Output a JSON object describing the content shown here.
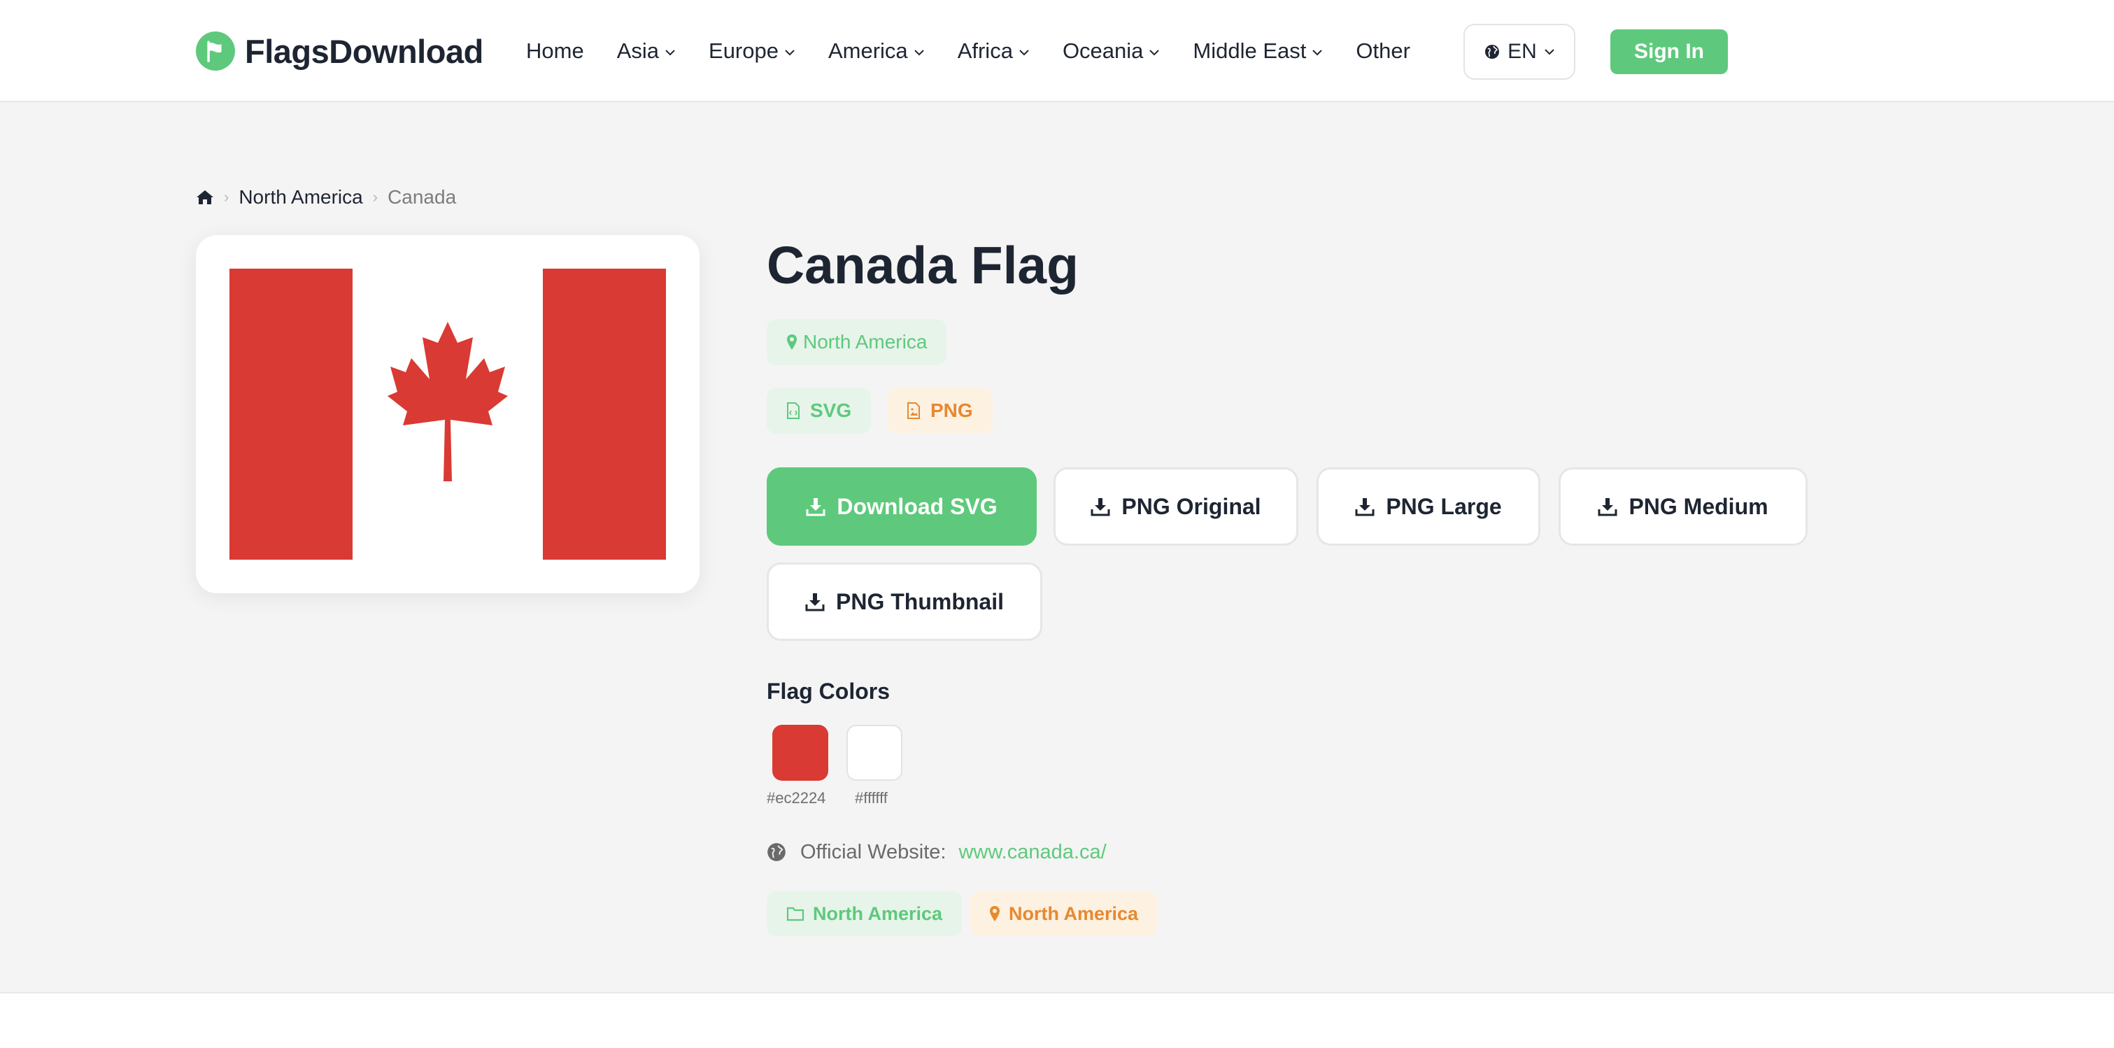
{
  "brand": {
    "name": "FlagsDownload",
    "accent": "#5ec97c"
  },
  "nav": {
    "items": [
      {
        "label": "Home",
        "dropdown": false
      },
      {
        "label": "Asia",
        "dropdown": true
      },
      {
        "label": "Europe",
        "dropdown": true
      },
      {
        "label": "America",
        "dropdown": true
      },
      {
        "label": "Africa",
        "dropdown": true
      },
      {
        "label": "Oceania",
        "dropdown": true
      },
      {
        "label": "Middle East",
        "dropdown": true
      },
      {
        "label": "Other",
        "dropdown": false
      }
    ],
    "language": "EN",
    "sign_in": "Sign In"
  },
  "breadcrumb": {
    "parent": "North America",
    "current": "Canada"
  },
  "flag": {
    "title": "Canada Flag",
    "region": "North America",
    "formats": [
      "SVG",
      "PNG"
    ],
    "downloads": {
      "svg": "Download SVG",
      "png_original": "PNG Original",
      "png_large": "PNG Large",
      "png_medium": "PNG Medium",
      "png_thumbnail": "PNG Thumbnail"
    },
    "colors_title": "Flag Colors",
    "colors": [
      "#ec2224",
      "#ffffff"
    ],
    "website_label": "Official Website:",
    "website_url": "www.canada.ca/",
    "tags": {
      "category": "North America",
      "location": "North America"
    }
  },
  "theme": {
    "orange": "#e7892f",
    "flag_red": "#d93a33"
  }
}
